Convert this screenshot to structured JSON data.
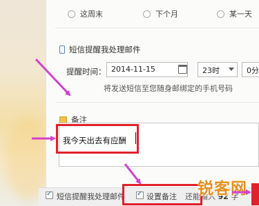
{
  "repeat_options": [
    {
      "label": "这周末",
      "selected": false
    },
    {
      "label": "下个月",
      "selected": false
    },
    {
      "label": "某一天",
      "selected": false
    }
  ],
  "sms_section": {
    "title": "短信提醒我处理邮件",
    "time_label": "提醒时间：",
    "date_value": "2014-11-15",
    "hour_value": "23时",
    "minute_value": "0分",
    "hint": "将发送短信至您随身邮绑定的手机号码"
  },
  "note_section": {
    "title": "备注",
    "text": "我今天出去有应酬"
  },
  "bottom_bar": {
    "sms_checkbox_label": "短信提醒我处理邮件",
    "note_checkbox_label": "设置备注",
    "count_prefix": "还能输入",
    "count_value": "92",
    "count_suffix": "字"
  },
  "watermark": "锐客网",
  "colors": {
    "annotation_red": "#e0202a",
    "arrow_magenta": "#d43fd0",
    "watermark_orange": "#e8901f"
  }
}
